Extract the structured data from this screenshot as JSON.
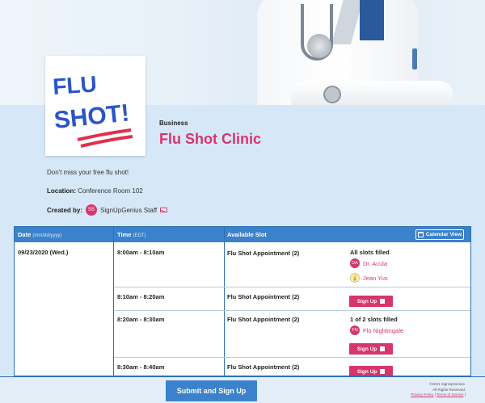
{
  "header": {
    "banner_image": "doctor-photo"
  },
  "event": {
    "logo_text": "FLU SHOT!",
    "category": "Business",
    "title": "Flu Shot Clinic",
    "description": "Don't miss your free flu shot!",
    "location_label": "Location:",
    "location_value": "Conference Room 102",
    "created_label": "Created by:",
    "creator_initials": "SS",
    "creator_name": "SignUpGenius Staff"
  },
  "table": {
    "col_date": "Date",
    "col_date_hint": "(mm/dd/yyyy)",
    "col_time": "Time",
    "col_time_hint": "(EDT)",
    "col_slot": "Available Slot",
    "calendar_view": "Calendar View",
    "date": "09/23/2020 (Wed.)",
    "rows": [
      {
        "time": "8:00am - 8:10am",
        "slot": "Flu Shot Appointment (2)",
        "status": "All slots filled",
        "people": [
          {
            "initials": "DA",
            "name": "Dr. Acula"
          },
          {
            "initials": "",
            "name": "Jean Yus"
          }
        ]
      },
      {
        "time": "8:10am - 8:20am",
        "slot": "Flu Shot Appointment (2)",
        "button": "Sign Up"
      },
      {
        "time": "8:20am - 8:30am",
        "slot": "Flu Shot Appointment (2)",
        "status": "1 of 2 slots filled",
        "people": [
          {
            "initials": "FN",
            "name": "Flo Nightingale"
          }
        ],
        "button": "Sign Up"
      },
      {
        "time": "8:30am - 8:40am",
        "slot": "Flu Shot Appointment (2)",
        "button": "Sign Up"
      }
    ]
  },
  "footer": {
    "submit": "Submit and Sign Up",
    "copyright": "©2021 SignUpGenius.",
    "rights": "All Rights Reserved.",
    "privacy": "Privacy Policy",
    "terms": "Terms of Service",
    "sep": "|"
  },
  "colors": {
    "accent": "#d6366b",
    "header_blue": "#3b82cc",
    "page_bg": "#d6e8f7"
  }
}
